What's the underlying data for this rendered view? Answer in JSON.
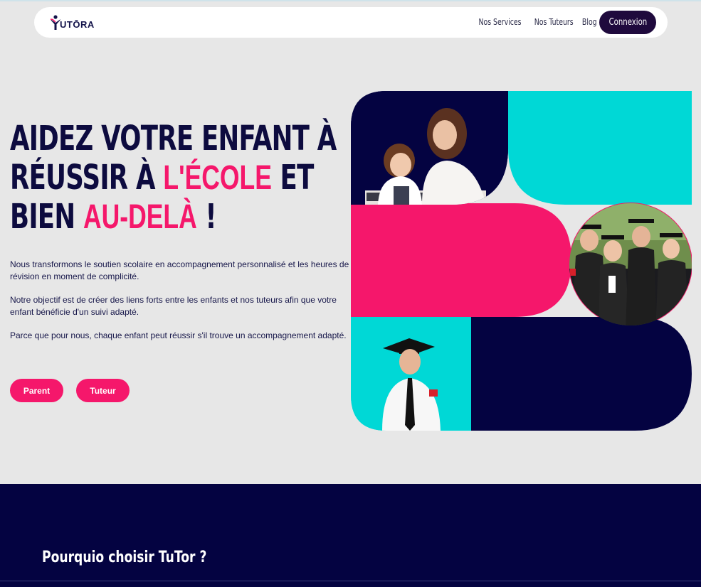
{
  "brand": {
    "logo_text": "UTŌRA",
    "colors": {
      "navy": "#040341",
      "pink": "#f5176b",
      "cyan": "#00d8d6",
      "connexion_bg": "#1f0a3d"
    }
  },
  "nav": {
    "links": [
      "Nos Services",
      "Nos Tuteurs",
      "Blog"
    ],
    "connexion_label": "Connexion"
  },
  "hero": {
    "line1": "AIDEZ VOTRE ENFANT À",
    "line2_prefix": "RÉUSSIR À ",
    "line2_highlight": "L'ÉCOLE",
    "line2_suffix": " ET",
    "line3_prefix": "BIEN ",
    "line3_highlight": "AU-DELÀ",
    "line3_suffix": " !",
    "paragraphs": [
      "Nous transformons le soutien scolaire en accompagnement personnalisé et les heures de révision en moment de complicité.",
      "Notre objectif est de créer des liens forts entre les enfants et nos tuteurs afin que votre enfant bénéficie d'un suivi adapté.",
      "Parce que pour nous, chaque enfant peut réussir s'il trouve un accompagnement adapté."
    ],
    "buttons": {
      "parent": "Parent",
      "tuteur": "Tuteur"
    }
  },
  "collage": {
    "photos": [
      "mother-daughter-photo",
      "graduates-group-photo",
      "graduate-man-photo"
    ]
  },
  "section": {
    "title": "Pourquio choisir TuTor ?"
  }
}
